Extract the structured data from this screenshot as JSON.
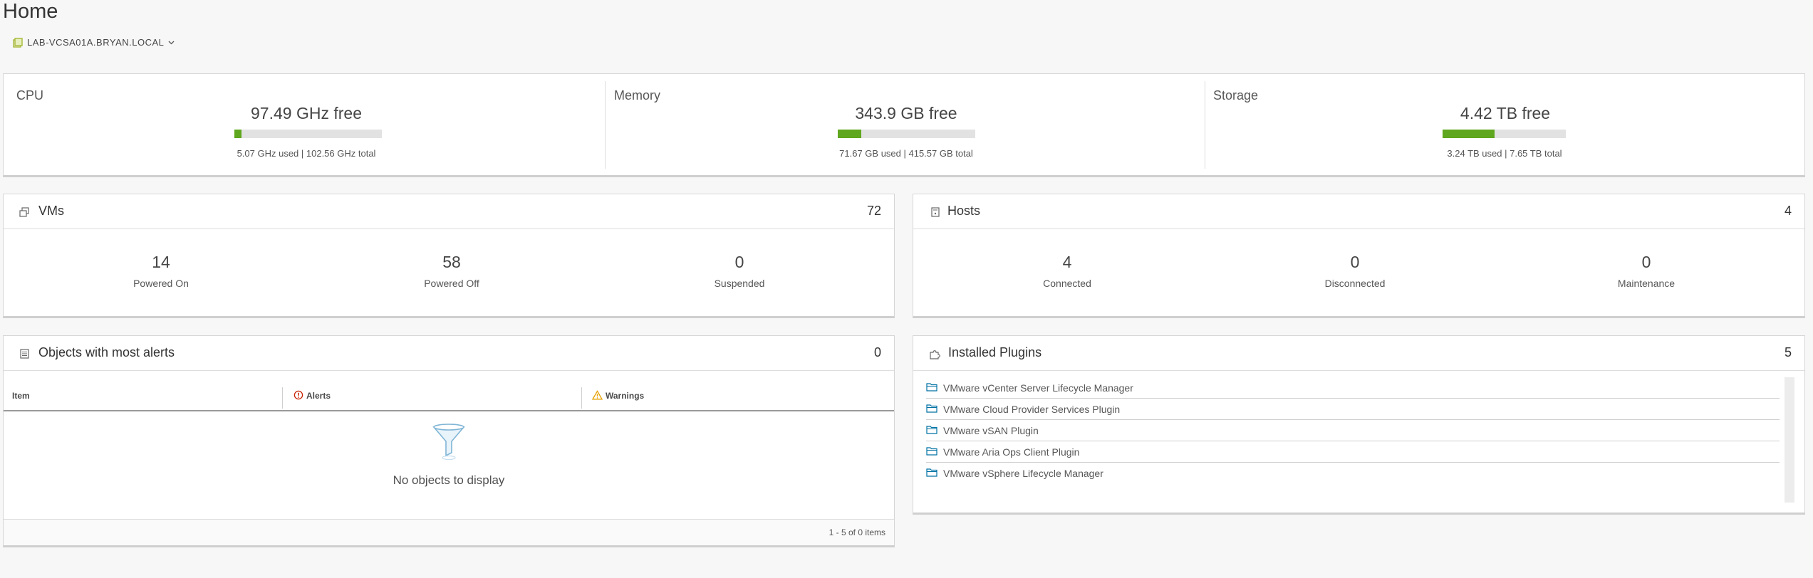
{
  "page": {
    "title": "Home"
  },
  "vcenter": {
    "name": "LAB-VCSA01A.BRYAN.LOCAL",
    "icon": "vcenter-icon"
  },
  "resources": {
    "cpu": {
      "title": "CPU",
      "free": "97.49 GHz free",
      "used_total": "5.07 GHz used | 102.56 GHz total",
      "used_fraction": 0.049
    },
    "memory": {
      "title": "Memory",
      "free": "343.9 GB free",
      "used_total": "71.67 GB used | 415.57 GB total",
      "used_fraction": 0.172
    },
    "storage": {
      "title": "Storage",
      "free": "4.42 TB free",
      "used_total": "3.24 TB used | 7.65 TB total",
      "used_fraction": 0.424
    },
    "bar_color": "#5fa71e"
  },
  "vms": {
    "title": "VMs",
    "count": "72",
    "icon": "vm-icon",
    "stats": [
      {
        "value": "14",
        "label": "Powered On"
      },
      {
        "value": "58",
        "label": "Powered Off"
      },
      {
        "value": "0",
        "label": "Suspended"
      }
    ]
  },
  "hosts": {
    "title": "Hosts",
    "count": "4",
    "icon": "host-icon",
    "stats": [
      {
        "value": "4",
        "label": "Connected"
      },
      {
        "value": "0",
        "label": "Disconnected"
      },
      {
        "value": "0",
        "label": "Maintenance"
      }
    ]
  },
  "alerts": {
    "title": "Objects with most alerts",
    "count": "0",
    "icon": "list-icon",
    "columns": [
      "Item",
      "Alerts",
      "Warnings"
    ],
    "empty_message": "No objects to display",
    "footer": "1 - 5 of 0 items",
    "alert_color": "#c92100",
    "warning_color": "#e5a000"
  },
  "plugins": {
    "title": "Installed Plugins",
    "count": "5",
    "icon": "plugin-icon",
    "items": [
      "VMware vCenter Server Lifecycle Manager",
      "VMware Cloud Provider Services Plugin",
      "VMware vSAN Plugin",
      "VMware Aria Ops Client Plugin",
      "VMware vSphere Lifecycle Manager"
    ],
    "folder_color": "#0072a3"
  }
}
